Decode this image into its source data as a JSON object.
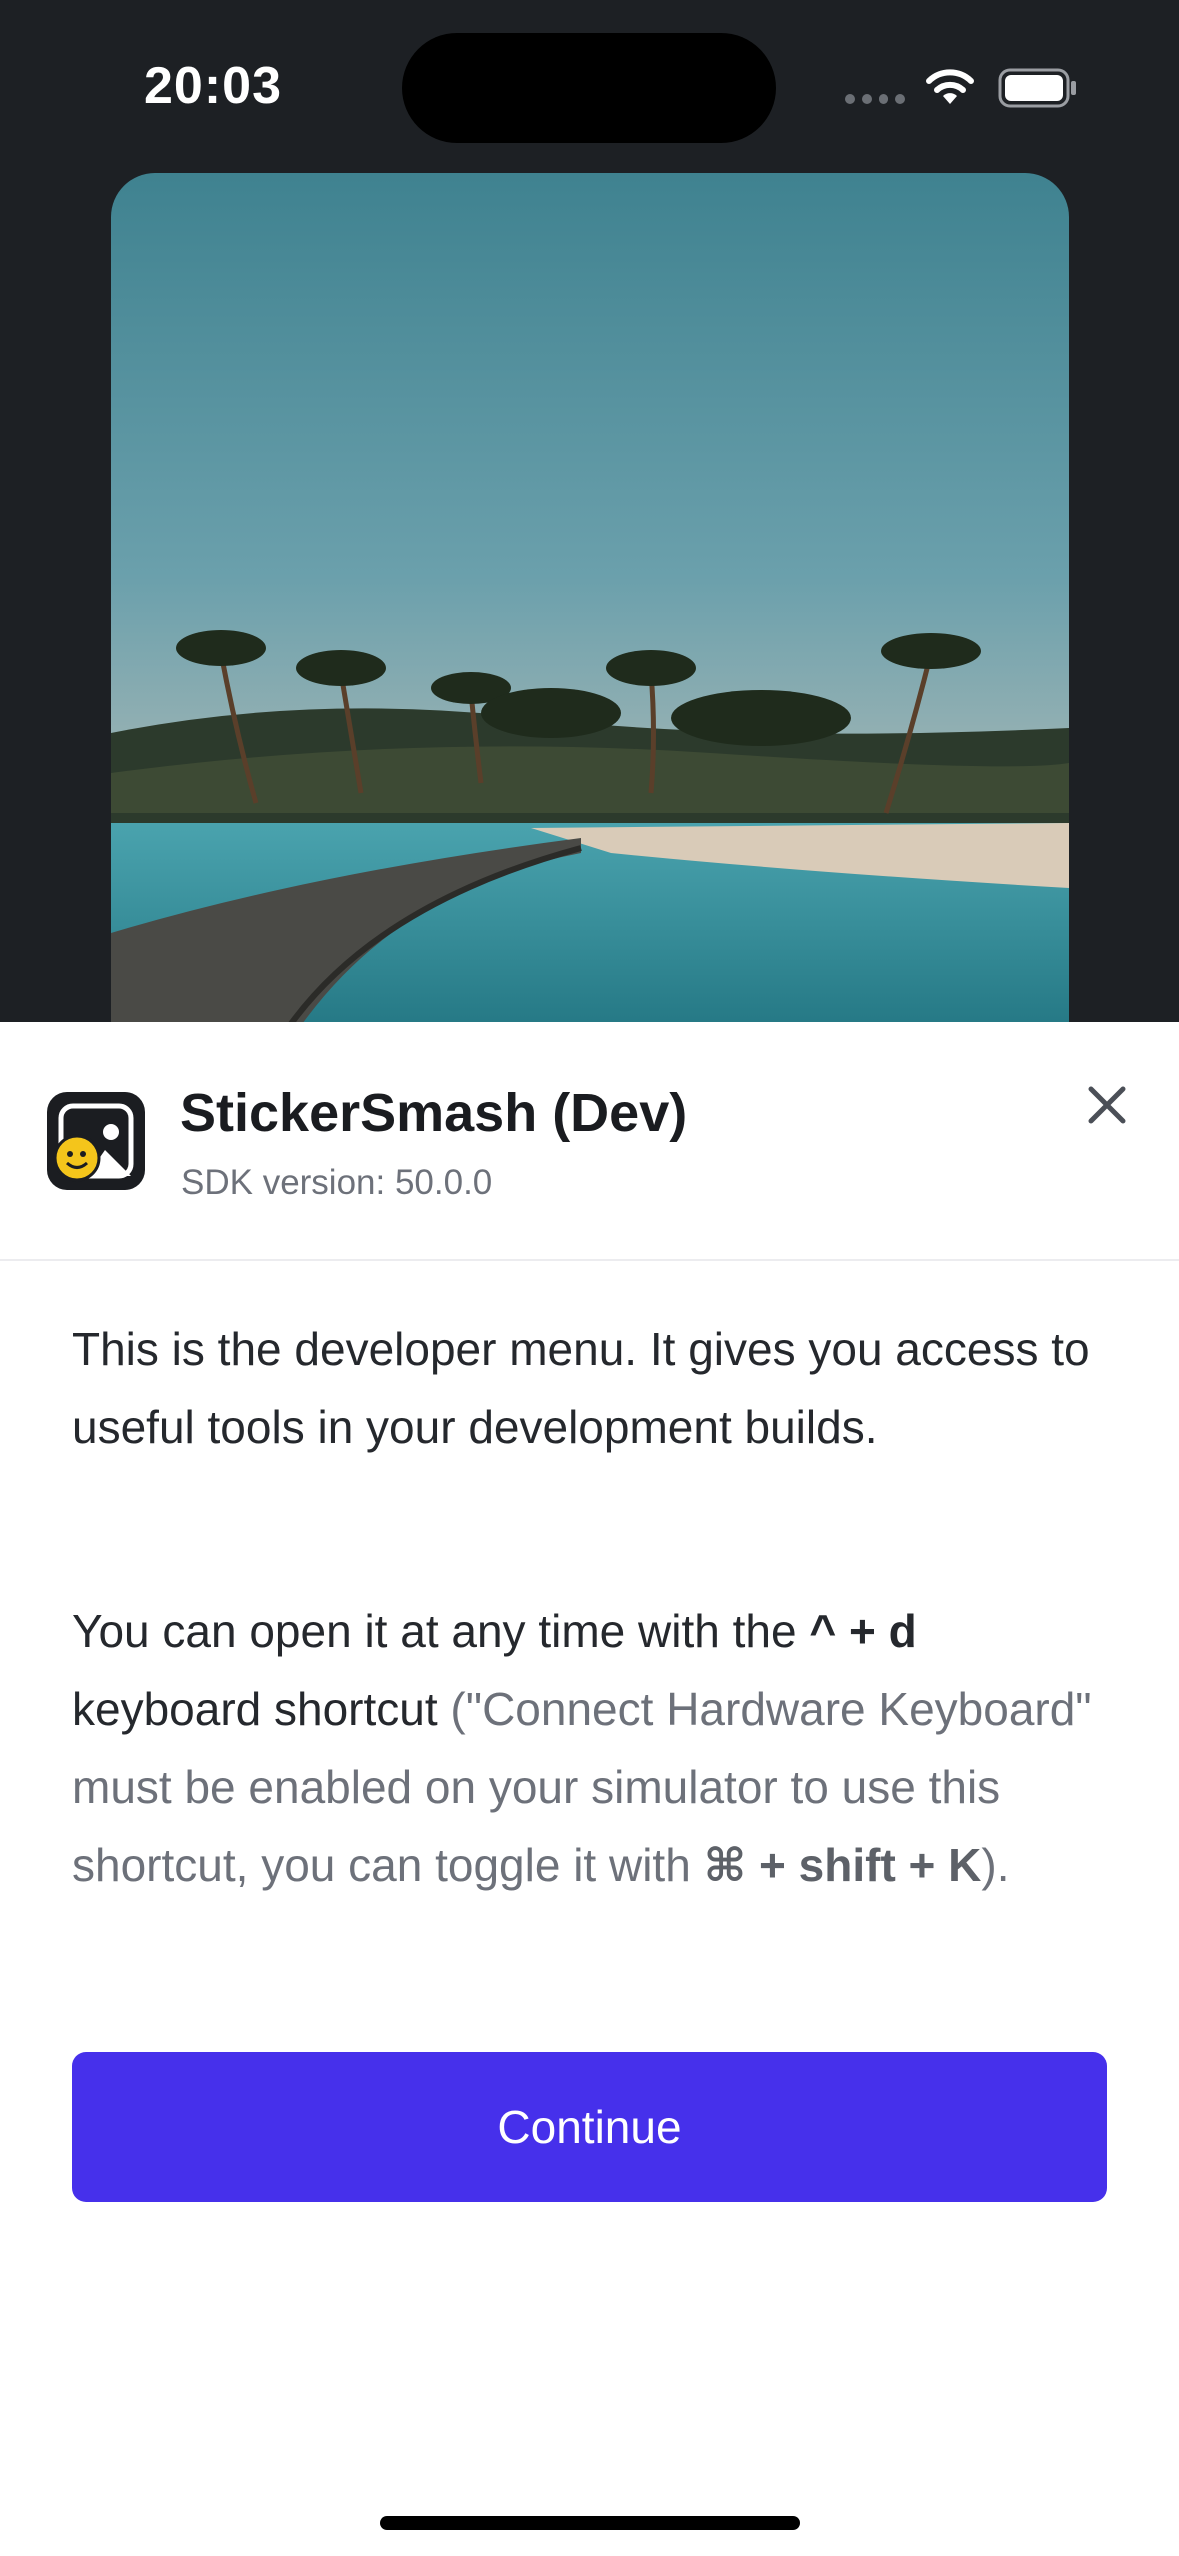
{
  "status_bar": {
    "time": "20:03"
  },
  "app": {
    "name": "StickerSmash (Dev)",
    "sdk_version": "SDK version: 50.0.0",
    "icon": "sticker-smash-app-icon"
  },
  "intro": {
    "paragraph1": "This is the developer menu. It gives you access to useful tools in your development builds.",
    "p2_lead": "You can open it at any time with the ",
    "p2_shortcut": "^ + d",
    "p2_kb": "keyboard shortcut",
    "p2_note_open": " (\"Connect Hardware Keyboard\" must be enabled on your simulator to use this shortcut, you can toggle it with ",
    "p2_toggle": "⌘ + shift + K",
    "p2_close": ")."
  },
  "actions": {
    "continue_label": "Continue"
  },
  "icons": {
    "close": "close-icon",
    "wifi": "wifi-icon",
    "battery": "battery-icon",
    "signal": "signal-icon"
  },
  "colors": {
    "accent": "#4630eb",
    "top_background": "#1d2024",
    "text": "#25282d",
    "muted": "#6d717a"
  }
}
